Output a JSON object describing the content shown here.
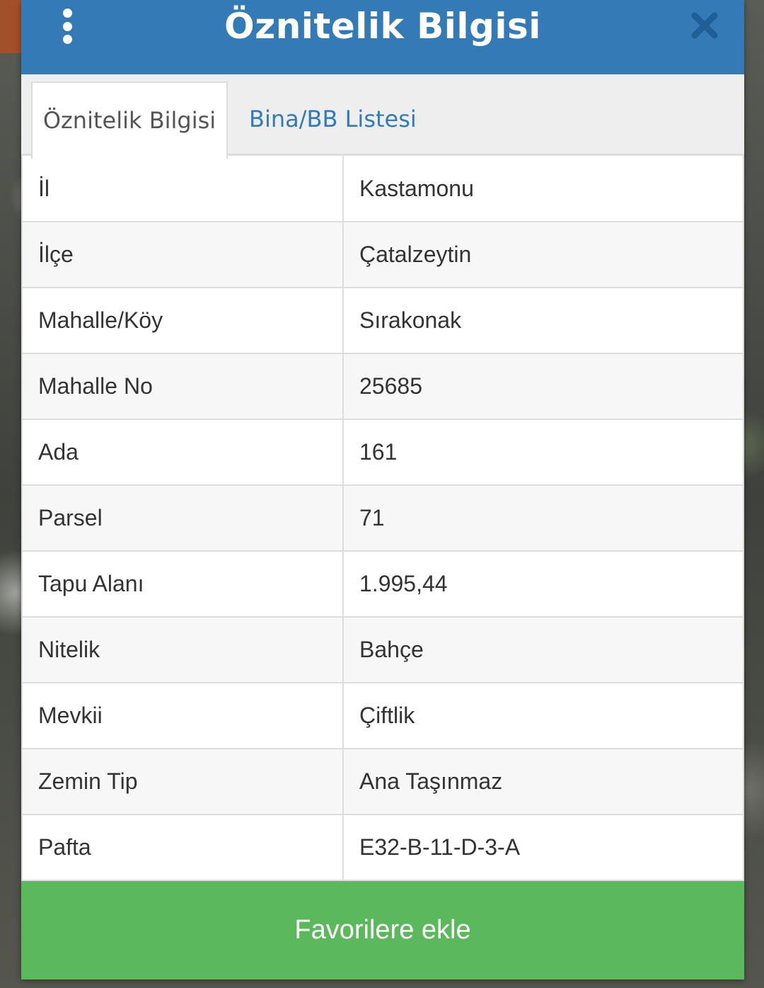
{
  "header": {
    "title": "Öznitelik Bilgisi"
  },
  "tabs": [
    {
      "label": "Öznitelik Bilgisi",
      "active": true
    },
    {
      "label": "Bina/BB Listesi",
      "active": false
    }
  ],
  "attributes": [
    {
      "key": "İl",
      "value": "Kastamonu"
    },
    {
      "key": "İlçe",
      "value": "Çatalzeytin"
    },
    {
      "key": "Mahalle/Köy",
      "value": "Sırakonak"
    },
    {
      "key": "Mahalle No",
      "value": "25685"
    },
    {
      "key": "Ada",
      "value": "161"
    },
    {
      "key": "Parsel",
      "value": "71"
    },
    {
      "key": "Tapu Alanı",
      "value": "1.995,44"
    },
    {
      "key": "Nitelik",
      "value": "Bahçe"
    },
    {
      "key": "Mevkii",
      "value": "Çiftlik"
    },
    {
      "key": "Zemin Tip",
      "value": "Ana Taşınmaz"
    },
    {
      "key": "Pafta",
      "value": "E32-B-11-D-3-A"
    }
  ],
  "footer": {
    "favorite_label": "Favorilere ekle"
  },
  "colors": {
    "header": "#337ab7",
    "favorite_button": "#5cb85c",
    "close_icon": "#1f5f96"
  },
  "icons": {
    "menu": "vertical-dots-icon",
    "close": "close-icon"
  }
}
